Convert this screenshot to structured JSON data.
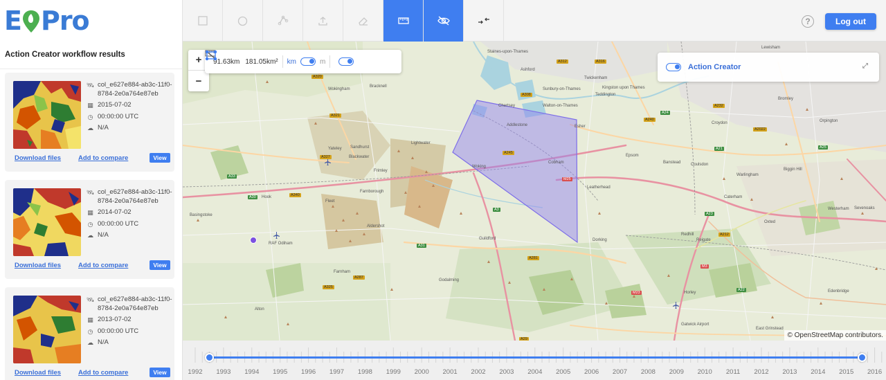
{
  "header": {
    "logo_text_left": "E",
    "logo_text_right": "Pro",
    "logout_label": "Log out",
    "help_symbol": "?"
  },
  "toolbar": {
    "tools": [
      {
        "name": "draw-rectangle-tool",
        "icon": "square-icon",
        "active": false
      },
      {
        "name": "draw-circle-tool",
        "icon": "circle-icon",
        "active": false
      },
      {
        "name": "draw-polygon-tool",
        "icon": "polygon-icon",
        "active": false
      },
      {
        "name": "upload-tool",
        "icon": "upload-icon",
        "active": false
      },
      {
        "name": "erase-tool",
        "icon": "eraser-icon",
        "active": false
      },
      {
        "name": "measure-tool",
        "icon": "ruler-icon",
        "active": true
      },
      {
        "name": "hide-layers-tool",
        "icon": "eye-off-icon",
        "active": true
      },
      {
        "name": "collapse-tool",
        "icon": "collapse-icon",
        "active": false
      }
    ]
  },
  "sidebar": {
    "title": "Action Creator workflow results",
    "results": [
      {
        "id": "col_e627e884-ab3c-11f0-8784-2e0a764e87eb",
        "date": "2015-07-02",
        "time": "00:00:00 UTC",
        "cloud": "N/A",
        "download": "Download files",
        "compare": "Add to compare",
        "view": "View"
      },
      {
        "id": "col_e627e884-ab3c-11f0-8784-2e0a764e87eb",
        "date": "2014-07-02",
        "time": "00:00:00 UTC",
        "cloud": "N/A",
        "download": "Download files",
        "compare": "Add to compare",
        "view": "View"
      },
      {
        "id": "col_e627e884-ab3c-11f0-8784-2e0a764e87eb",
        "date": "2013-07-02",
        "time": "00:00:00 UTC",
        "cloud": "N/A",
        "download": "Download files",
        "compare": "Add to compare",
        "view": "View"
      }
    ]
  },
  "map": {
    "zoom_in": "+",
    "zoom_out": "−",
    "measure": {
      "distance": "91.63km",
      "area": "181.05km²",
      "unit_km": "km",
      "unit_m": "m"
    },
    "action_creator_label": "Action Creator",
    "attribution": "© OpenStreetMap contributors.",
    "places": [
      "Staines-upon-Thames",
      "Ashford",
      "Twickenham",
      "Teddington",
      "Kingston upon Thames",
      "Sunbury-on-Thames",
      "Walton-on-Thames",
      "Chertsey",
      "Addlestone",
      "Esher",
      "Wokingham",
      "Bracknell",
      "Sandhurst",
      "Yateley",
      "Blackwater",
      "Lightwater",
      "Frimley",
      "Farnborough",
      "Fleet",
      "Aldershot",
      "Hook",
      "Basingstoke",
      "Woking",
      "Cobham",
      "Leatherhead",
      "Epsom",
      "Banstead",
      "Coulsdon",
      "Croydon",
      "Caterham",
      "Warlingham",
      "Biggin Hill",
      "Orpington",
      "Sevenoaks",
      "Westerham",
      "Oxted",
      "Reigate",
      "Redhill",
      "Dorking",
      "Guildford",
      "Farnham",
      "Godalming",
      "Alton",
      "Horley",
      "Gatwick Airport",
      "East Grinstead",
      "Edenbridge",
      "Bromley",
      "Lewisham",
      "RAF Odiham"
    ],
    "roads": [
      "A312",
      "A316",
      "A308",
      "A320",
      "A321",
      "A327",
      "A30",
      "A33",
      "A3",
      "A31",
      "A287",
      "A325",
      "A245",
      "M25",
      "A240",
      "A24",
      "A23",
      "A22",
      "A212",
      "A232",
      "A2022",
      "A21",
      "A25",
      "A281",
      "A29",
      "M23",
      "M3",
      "A340"
    ],
    "highlight_color": "#8f7ef2",
    "brand_color": "#3f7ef0"
  },
  "timeline": {
    "years": [
      "1992",
      "1993",
      "1994",
      "1995",
      "1996",
      "1997",
      "1998",
      "1999",
      "2000",
      "2001",
      "2002",
      "2003",
      "2004",
      "2005",
      "2006",
      "2007",
      "2008",
      "2009",
      "2010",
      "2011",
      "2012",
      "2013",
      "2014",
      "2015",
      "2016"
    ],
    "range_start": "1993",
    "range_end": "2016"
  }
}
